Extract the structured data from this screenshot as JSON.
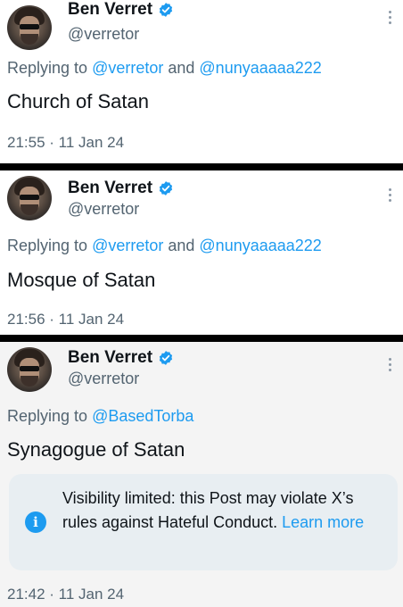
{
  "posts": [
    {
      "author_name": "Ben Verret",
      "handle": "@verretor",
      "reply_prefix": "Replying to ",
      "reply_to_1": "@verretor",
      "reply_and": " and ",
      "reply_to_2": "@nunyaaaaa222",
      "text": "Church of Satan",
      "time": "21:55 · 11 Jan 24"
    },
    {
      "author_name": "Ben Verret",
      "handle": "@verretor",
      "reply_prefix": "Replying to ",
      "reply_to_1": "@verretor",
      "reply_and": " and ",
      "reply_to_2": "@nunyaaaaa222",
      "text": "Mosque of Satan",
      "time": "21:56 · 11 Jan 24"
    },
    {
      "author_name": "Ben Verret",
      "handle": "@verretor",
      "reply_prefix": "Replying to ",
      "reply_to_1": "@BasedTorba",
      "text": "Synagogue of Satan",
      "notice_text": "Visibility limited: this Post may violate X’s rules against Hateful Conduct. ",
      "notice_link": "Learn more",
      "time": "21:42 · 11 Jan 24"
    }
  ],
  "colors": {
    "accent": "#1d9bf0",
    "secondary_text": "#536471",
    "primary_text": "#0f1419",
    "notice_bg": "#e8eef2"
  },
  "icons": [
    "verified-badge-icon",
    "more-options-icon",
    "info-icon"
  ]
}
